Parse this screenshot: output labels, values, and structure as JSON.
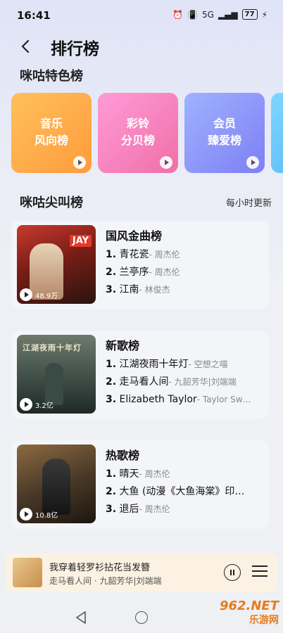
{
  "status_bar": {
    "time": "16:41",
    "network": "5G",
    "battery": "77"
  },
  "header": {
    "title": "排行榜"
  },
  "featured": {
    "section_title": "咪咕特色榜",
    "cards": [
      {
        "label": "音乐\n风向榜",
        "line1": "音乐",
        "line2": "风向榜"
      },
      {
        "label": "彩铃\n分贝榜",
        "line1": "彩铃",
        "line2": "分贝榜"
      },
      {
        "label": "会员\n臻爱榜",
        "line1": "会员",
        "line2": "臻爱榜"
      }
    ]
  },
  "charts_section": {
    "title": "咪咕尖叫榜",
    "update_note": "每小时更新"
  },
  "charts": [
    {
      "name": "国风金曲榜",
      "play_count": "48.9万",
      "tracks": [
        {
          "num": "1.",
          "title": "青花瓷",
          "artist": "- 周杰伦"
        },
        {
          "num": "2.",
          "title": "兰亭序",
          "artist": "- 周杰伦"
        },
        {
          "num": "3.",
          "title": "江南",
          "artist": "- 林俊杰"
        }
      ]
    },
    {
      "name": "新歌榜",
      "play_count": "3.2亿",
      "tracks": [
        {
          "num": "1.",
          "title": "江湖夜雨十年灯",
          "artist": "- 空想之喵"
        },
        {
          "num": "2.",
          "title": "走马看人间",
          "artist": "- 九韶芳华|刘端端"
        },
        {
          "num": "3.",
          "title": "Elizabeth Taylor",
          "artist": "- Taylor Sw…"
        }
      ]
    },
    {
      "name": "热歌榜",
      "play_count": "10.8亿",
      "tracks": [
        {
          "num": "1.",
          "title": "晴天",
          "artist": "- 周杰伦"
        },
        {
          "num": "2.",
          "title": "大鱼 (动漫《大鱼海棠》印…",
          "artist": ""
        },
        {
          "num": "3.",
          "title": "退后",
          "artist": "- 周杰伦"
        }
      ]
    }
  ],
  "mini_player": {
    "title": "我穿着轻罗衫拈花当发簪",
    "subtitle": "走马看人间 · 九韶芳华|刘端端"
  },
  "watermark": {
    "line1": "962.NET",
    "line2": "乐游网"
  }
}
